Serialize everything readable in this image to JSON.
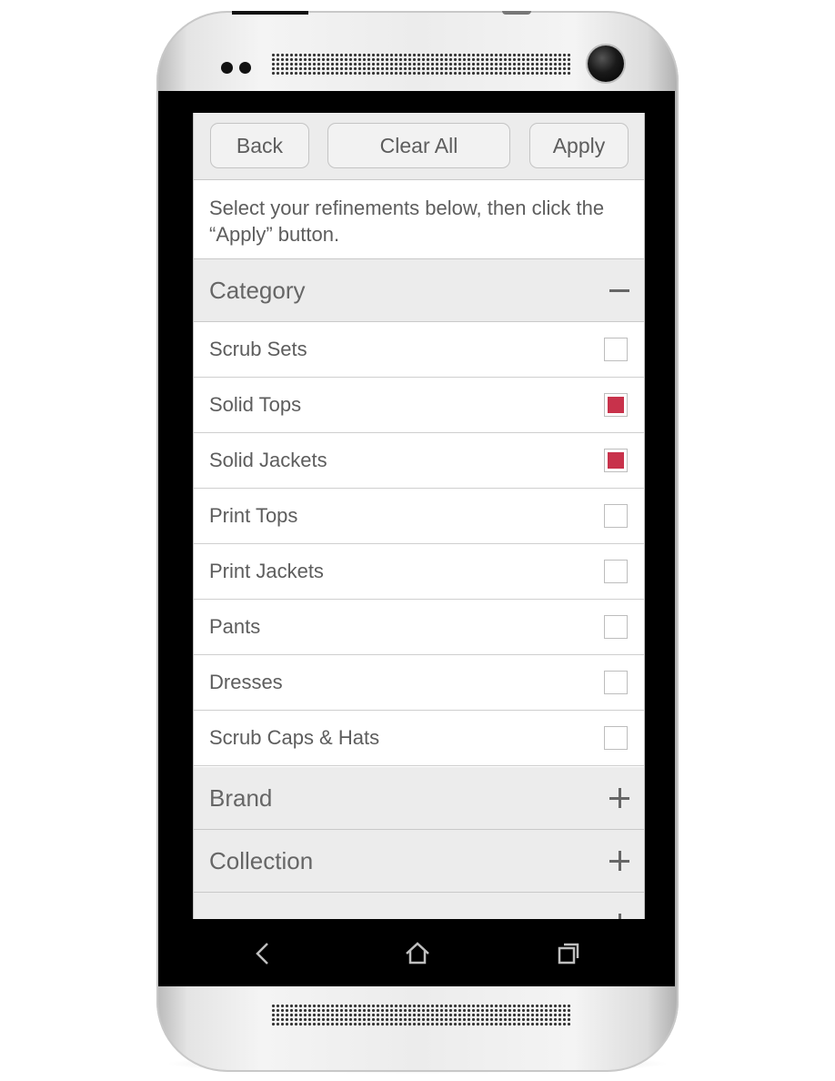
{
  "toolbar": {
    "back_label": "Back",
    "clear_label": "Clear All",
    "apply_label": "Apply"
  },
  "intro_text": "Select your refinements below, then click the “Apply” button.",
  "check_color": "#c8324b",
  "sections": {
    "category": {
      "title": "Category",
      "expanded": true,
      "items": [
        {
          "label": "Scrub Sets",
          "checked": false
        },
        {
          "label": "Solid Tops",
          "checked": true
        },
        {
          "label": "Solid Jackets",
          "checked": true
        },
        {
          "label": "Print Tops",
          "checked": false
        },
        {
          "label": "Print Jackets",
          "checked": false
        },
        {
          "label": "Pants",
          "checked": false
        },
        {
          "label": "Dresses",
          "checked": false
        },
        {
          "label": "Scrub Caps & Hats",
          "checked": false
        }
      ]
    },
    "brand": {
      "title": "Brand",
      "expanded": false
    },
    "collection": {
      "title": "Collection",
      "expanded": false
    }
  },
  "icons": {
    "collapse": "minus-icon",
    "expand": "plus-icon",
    "nav_back": "back-arrow-icon",
    "nav_home": "home-icon",
    "nav_recent": "recent-apps-icon"
  }
}
